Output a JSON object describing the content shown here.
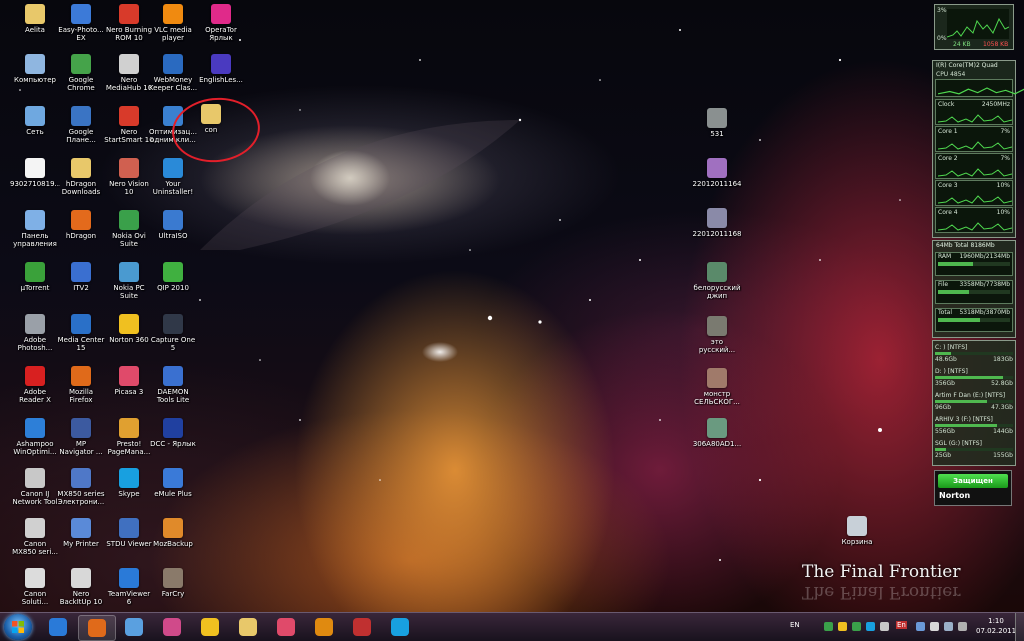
{
  "desktop_icons": [
    {
      "label": "Aelita",
      "icon": "folder-icon",
      "color": "#e8c86a"
    },
    {
      "label": "Компьютер",
      "icon": "computer-icon",
      "color": "#8fb6e0"
    },
    {
      "label": "Сеть",
      "icon": "network-icon",
      "color": "#6fa8e0"
    },
    {
      "label": "9302710819...",
      "icon": "document-icon",
      "color": "#f4f4f4"
    },
    {
      "label": "Панель\nуправления",
      "icon": "control-panel-icon",
      "color": "#7fb0e6"
    },
    {
      "label": "µTorrent",
      "icon": "utorrent-icon",
      "color": "#3aa13a"
    },
    {
      "label": "Adobe\nPhotosh...",
      "icon": "photoshop-icon",
      "color": "#9aa0a8"
    },
    {
      "label": "Adobe\nReader X",
      "icon": "adobe-reader-icon",
      "color": "#d82020"
    },
    {
      "label": "Ashampoo\nWinOptimi...",
      "icon": "ashampoo-icon",
      "color": "#2d7fd8"
    },
    {
      "label": "Canon IJ\nNetwork Tool",
      "icon": "canon-icon",
      "color": "#c8c8c8"
    },
    {
      "label": "Canon\nMX850 seri...",
      "icon": "printer-icon",
      "color": "#d0d0d0"
    },
    {
      "label": "Canon\nSoluti...",
      "icon": "canon-solution-icon",
      "color": "#dcdcdc"
    },
    {
      "label": "Easy-Photo...\nEX",
      "icon": "easy-photo-icon",
      "color": "#3c7ad8"
    },
    {
      "label": "Google\nChrome",
      "icon": "chrome-icon",
      "color": "#45a34a"
    },
    {
      "label": "Google\nПлане...",
      "icon": "google-earth-icon",
      "color": "#3a74c4"
    },
    {
      "label": "hDragon\nDownloads",
      "icon": "folder-icon",
      "color": "#e8c86a"
    },
    {
      "label": "hDragon",
      "icon": "hdragon-icon",
      "color": "#e36a1c"
    },
    {
      "label": "ITV2",
      "icon": "itv-icon",
      "color": "#3a6fd0"
    },
    {
      "label": "Media Center\n15",
      "icon": "media-center-icon",
      "color": "#2a70c8"
    },
    {
      "label": "Mozilla\nFirefox",
      "icon": "firefox-icon",
      "color": "#e06a1a"
    },
    {
      "label": "MP\nNavigator ...",
      "icon": "mp-navigator-icon",
      "color": "#3c5aa0"
    },
    {
      "label": "MX850 series\nЭлектрони...",
      "icon": "manual-icon",
      "color": "#4f78c8"
    },
    {
      "label": "My Printer",
      "icon": "my-printer-icon",
      "color": "#5a8ad8"
    },
    {
      "label": "Nero\nBackItUp 10",
      "icon": "nero-backitup-icon",
      "color": "#d8d8d8"
    },
    {
      "label": "Nero Burning\nROM 10",
      "icon": "nero-burning-icon",
      "color": "#d83a2a"
    },
    {
      "label": "Nero\nMediaHub 10",
      "icon": "nero-mediahub-icon",
      "color": "#d0d0d0"
    },
    {
      "label": "Nero\nStartSmart 10",
      "icon": "nero-startsmart-icon",
      "color": "#d83a2a"
    },
    {
      "label": "Nero Vision\n10",
      "icon": "nero-vision-icon",
      "color": "#d06050"
    },
    {
      "label": "Nokia Ovi\nSuite",
      "icon": "nokia-ovi-icon",
      "color": "#3aa04a"
    },
    {
      "label": "Nokia PC\nSuite",
      "icon": "nokia-pc-suite-icon",
      "color": "#4a9ad0"
    },
    {
      "label": "Norton 360",
      "icon": "norton-icon",
      "color": "#f0c020"
    },
    {
      "label": "Picasa 3",
      "icon": "picasa-icon",
      "color": "#e04a6a"
    },
    {
      "label": "Presto!\nPageMana...",
      "icon": "presto-icon",
      "color": "#e0a030"
    },
    {
      "label": "Skype",
      "icon": "skype-icon",
      "color": "#18a0e0"
    },
    {
      "label": "STDU Viewer",
      "icon": "stdu-icon",
      "color": "#4070c0"
    },
    {
      "label": "TeamViewer\n6",
      "icon": "teamviewer-icon",
      "color": "#2a7ad8"
    },
    {
      "label": "VLC media\nplayer",
      "icon": "vlc-icon",
      "color": "#f08a10"
    },
    {
      "label": "WebMoney\nKeeper Clas...",
      "icon": "webmoney-icon",
      "color": "#2a6ac0"
    },
    {
      "label": "Оптимизац...\nодним кли...",
      "icon": "optimizer-icon",
      "color": "#3a80d0"
    },
    {
      "label": "Your\nUninstaller!",
      "icon": "uninstaller-icon",
      "color": "#2a8ad8"
    },
    {
      "label": "UltraISO",
      "icon": "ultraiso-icon",
      "color": "#3a7ad0"
    },
    {
      "label": "QIP 2010",
      "icon": "qip-icon",
      "color": "#40b040"
    },
    {
      "label": "Capture One\n5",
      "icon": "capture-one-icon",
      "color": "#303848"
    },
    {
      "label": "DAEMON\nTools Lite",
      "icon": "daemon-tools-icon",
      "color": "#3a70d0"
    },
    {
      "label": "DCC - Ярлык",
      "icon": "dcc-icon",
      "color": "#2040a0"
    },
    {
      "label": "eMule Plus",
      "icon": "emule-icon",
      "color": "#3a7ad8"
    },
    {
      "label": "MozBackup",
      "icon": "mozbackup-icon",
      "color": "#e08a2a"
    },
    {
      "label": "FarCry",
      "icon": "farcry-icon",
      "color": "#8a7a6a"
    },
    {
      "label": "OperaTor\nЯрлык",
      "icon": "opera-tor-icon",
      "color": "#e02a8a"
    },
    {
      "label": "EnglishLes...",
      "icon": "english-lessons-icon",
      "color": "#4a3ac0"
    },
    {
      "label": "con",
      "icon": "folder-icon",
      "color": "#e8c86a"
    },
    {
      "label": "531",
      "icon": "image-file-icon",
      "color": "#8a9090"
    },
    {
      "label": "22012011164",
      "icon": "image-file-icon",
      "color": "#a070c0"
    },
    {
      "label": "22012011168",
      "icon": "image-file-icon",
      "color": "#8a8aa8"
    },
    {
      "label": "белорусский\nджип",
      "icon": "image-file-icon",
      "color": "#5a8a6a"
    },
    {
      "label": "это\nрусский...",
      "icon": "image-file-icon",
      "color": "#7a7a70"
    },
    {
      "label": "монстр\nСЕЛЬСКОГ...",
      "icon": "image-file-icon",
      "color": "#a07a6a"
    },
    {
      "label": "306A80AD1...",
      "icon": "image-file-icon",
      "color": "#6a9a80"
    },
    {
      "label": "Корзина",
      "icon": "recycle-bin-icon",
      "color": "#c8d0d8"
    }
  ],
  "brand_text": "The Final Frontier",
  "net_gadget": {
    "top_pct": "3%",
    "bottom_pct": "0%",
    "down": "24 KB",
    "up": "1058 KB"
  },
  "cpu_gadget": {
    "title": "I(R) Core(TM)2 Quad",
    "model": "CPU 4854",
    "rows": [
      {
        "label": "Clock",
        "value": "2450MHz"
      },
      {
        "label": "Core 1",
        "value": "7%"
      },
      {
        "label": "Core 2",
        "value": "7%"
      },
      {
        "label": "Core 3",
        "value": "10%"
      },
      {
        "label": "Core 4",
        "value": "10%"
      }
    ]
  },
  "ram_gadget": {
    "title": "64Mb Total 8186Mb",
    "bars": [
      {
        "label": "RAM",
        "value": "1960Mb/2134Mb",
        "pct": 0.48
      },
      {
        "label": "File",
        "value": "3358Mb/7738Mb",
        "pct": 0.43
      },
      {
        "label": "Total",
        "value": "5318Mb/3870Mb",
        "pct": 0.58
      }
    ]
  },
  "drive_gadget": {
    "drives": [
      {
        "label": "C: ) [NTFS]",
        "used": "48.6Gb",
        "free": "183Gb",
        "pct": 0.21
      },
      {
        "label": "D: ) [NTFS]",
        "used": "356Gb",
        "free": "52.8Gb",
        "pct": 0.87
      },
      {
        "label": "Artim F Dan (E:) [NTFS]",
        "used": "96Gb",
        "free": "47.3Gb",
        "pct": 0.67
      },
      {
        "label": "ARHIV 3 (F:) [NTFS]",
        "used": "556Gb",
        "free": "144Gb",
        "pct": 0.79
      },
      {
        "label": "SGL (G:) [NTFS]",
        "used": "25Gb",
        "free": "155Gb",
        "pct": 0.14
      }
    ]
  },
  "norton_gadget": {
    "status": "Защищен",
    "brand": "Norton"
  },
  "taskbar": {
    "apps": [
      {
        "name": "ie",
        "icon": "internet-explorer-icon",
        "color": "#2a7ad8"
      },
      {
        "name": "firefox",
        "icon": "firefox-icon",
        "color": "#e06a1a",
        "active": true
      },
      {
        "name": "aero",
        "icon": "globe-icon",
        "color": "#5aa0e0"
      },
      {
        "name": "media",
        "icon": "media-player-icon",
        "color": "#d04a8a"
      },
      {
        "name": "norton",
        "icon": "norton-icon",
        "color": "#f0c020"
      },
      {
        "name": "explorer",
        "icon": "explorer-folder-icon",
        "color": "#e8c86a"
      },
      {
        "name": "picasa",
        "icon": "picasa-icon",
        "color": "#e04a6a"
      },
      {
        "name": "wmp",
        "icon": "windows-media-player-icon",
        "color": "#e08a10"
      },
      {
        "name": "nero",
        "icon": "nero-icon",
        "color": "#c03030"
      },
      {
        "name": "skype",
        "icon": "skype-icon",
        "color": "#18a0e0"
      }
    ],
    "tray": {
      "lang": "EN",
      "lang2": "En",
      "time": "1:10",
      "date": "07.02.2011"
    }
  }
}
